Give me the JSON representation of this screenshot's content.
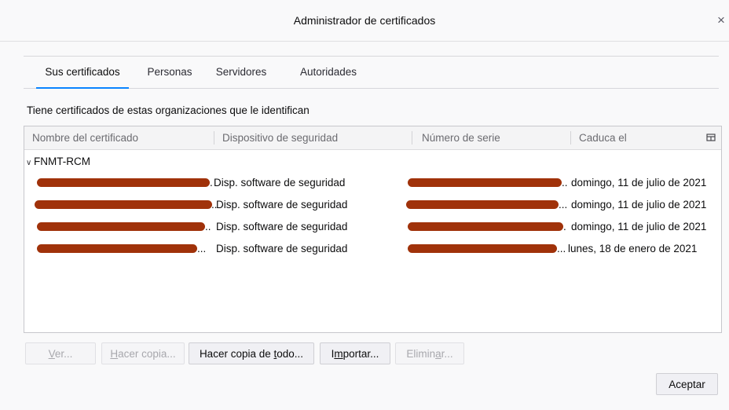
{
  "window": {
    "title": "Administrador de certificados",
    "close_glyph": "×"
  },
  "tabs": [
    {
      "label": "Sus certificados",
      "selected": true
    },
    {
      "label": "Personas",
      "selected": false
    },
    {
      "label": "Servidores",
      "selected": false
    },
    {
      "label": "Autoridades",
      "selected": false
    }
  ],
  "intro_text": "Tiene certificados de estas organizaciones que le identifican",
  "table": {
    "columns": [
      "Nombre del certificado",
      "Dispositivo de seguridad",
      "Número de serie",
      "Caduca el"
    ],
    "column_picker_icon": "column-picker-icon",
    "group": {
      "name": "FNMT-RCM",
      "expanded": true
    },
    "rows": [
      {
        "name_suffix": ".",
        "device": "Disp. software de seguridad",
        "serial_suffix": "..",
        "expires": "domingo, 11 de julio de 2021"
      },
      {
        "name_suffix": "..",
        "device": "Disp. software de seguridad",
        "serial_suffix": "...",
        "expires": "domingo, 11 de julio de 2021"
      },
      {
        "name_suffix": "..",
        "device": "Disp. software de seguridad",
        "serial_suffix": ".",
        "expires": "domingo, 11 de julio de 2021"
      },
      {
        "name_suffix": "...",
        "device": "Disp. software de seguridad",
        "serial_suffix": "...",
        "expires": "lunes, 18 de enero de 2021"
      }
    ],
    "redaction_color": "#a0320a"
  },
  "buttons": {
    "ver": {
      "pre": "",
      "key": "V",
      "post": "er..."
    },
    "hacer_copia": {
      "pre": "",
      "key": "H",
      "post": "acer copia..."
    },
    "hacer_copia_todo": {
      "pre": "Hacer copia de ",
      "key": "t",
      "post": "odo..."
    },
    "importar": {
      "pre": "I",
      "key": "m",
      "post": "portar..."
    },
    "eliminar": {
      "pre": "Elimin",
      "key": "a",
      "post": "r..."
    },
    "aceptar": {
      "label": "Aceptar"
    }
  },
  "accent_color": "#0a84ff"
}
